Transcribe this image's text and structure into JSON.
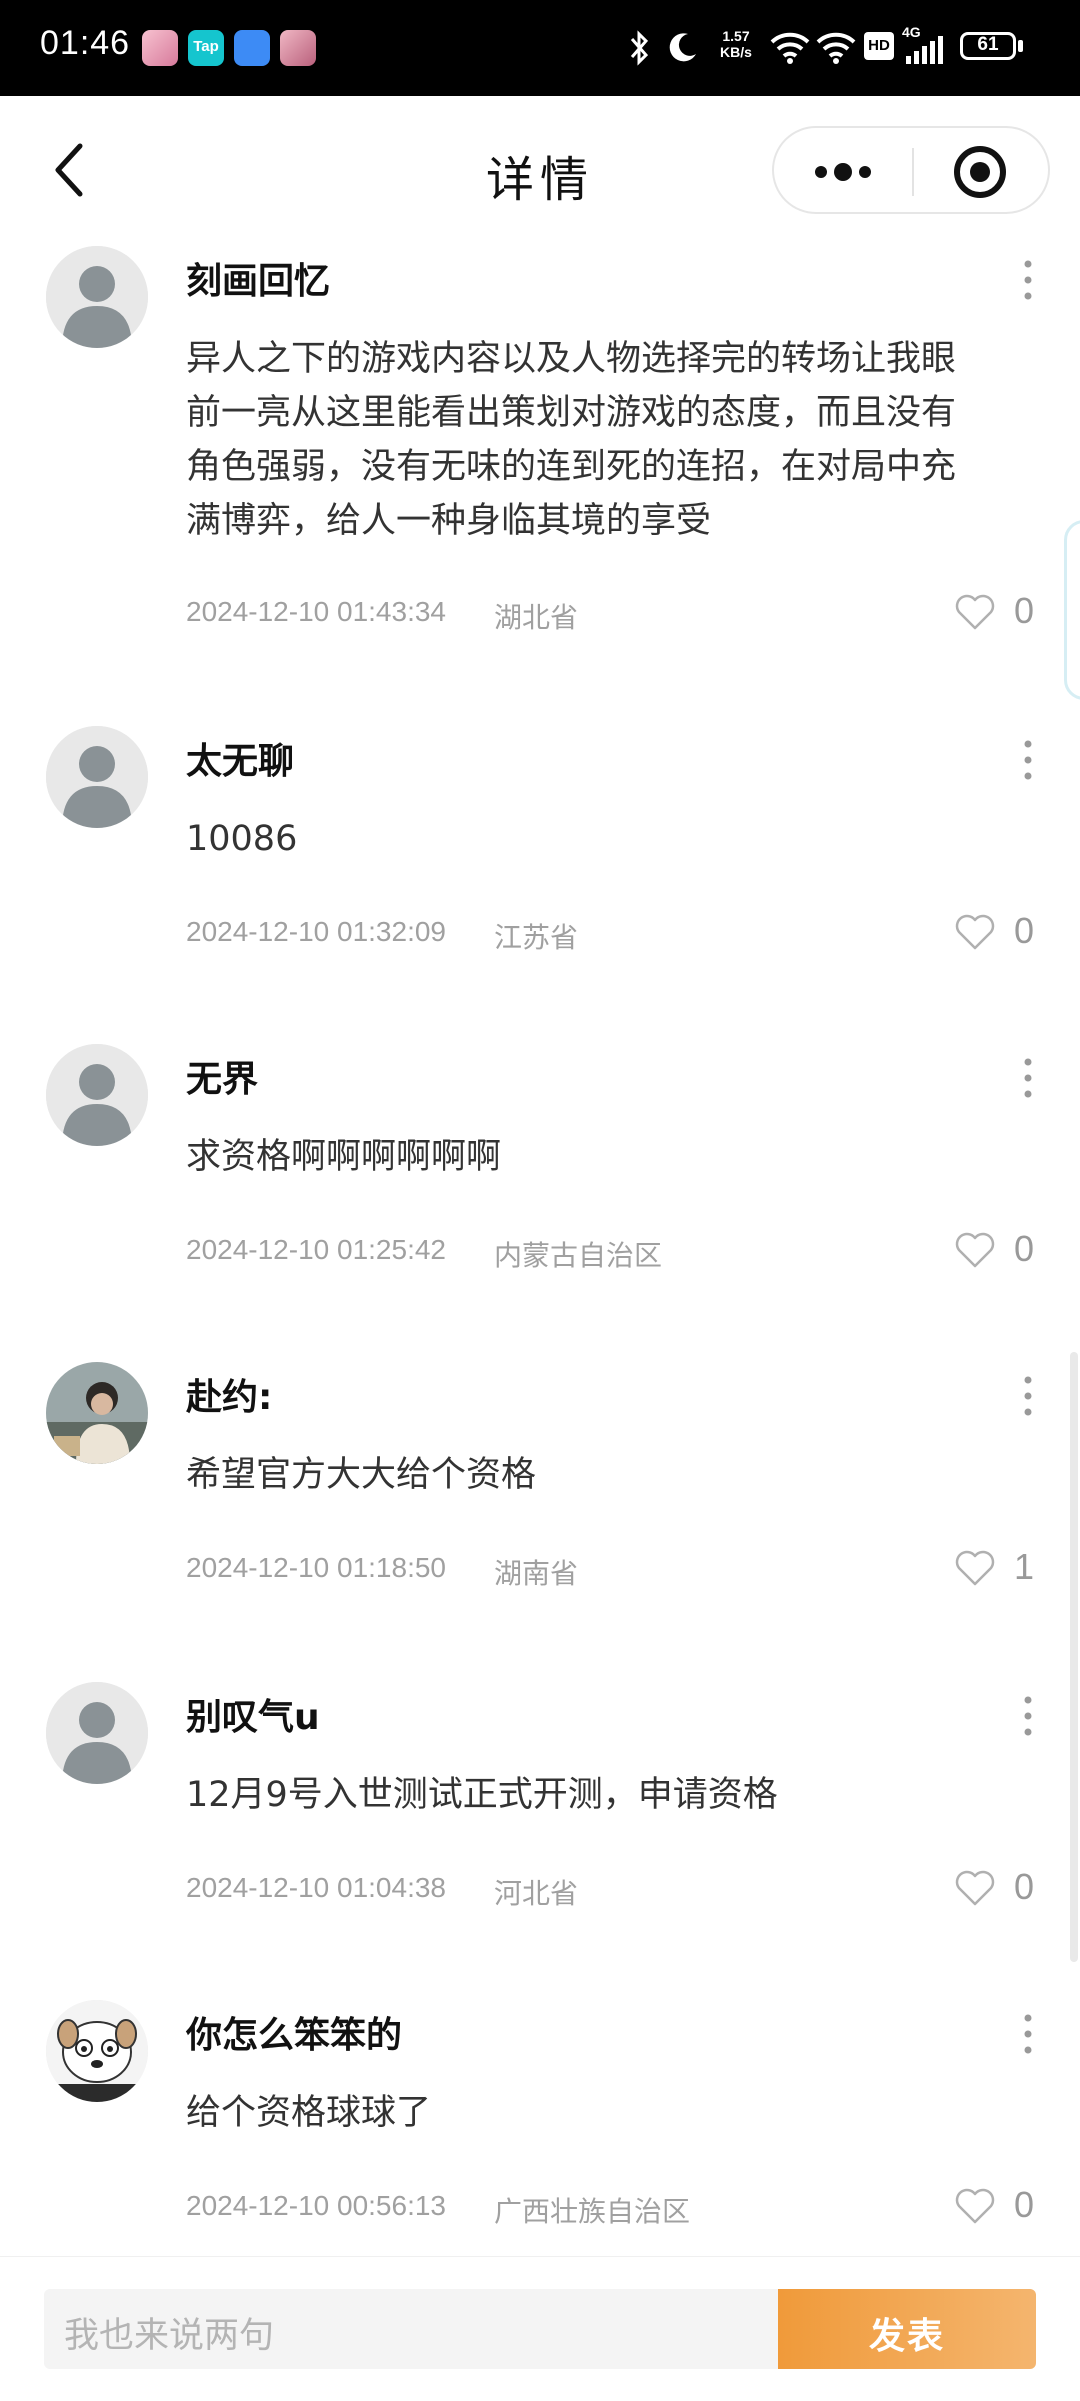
{
  "status_bar": {
    "time": "01:46",
    "net_speed_value": "1.57",
    "net_speed_unit": "KB/s",
    "hd_label": "HD",
    "network_type": "4G",
    "battery": "61",
    "app_icons": [
      "game-app-icon",
      "taptap-app-icon",
      "store-app-icon",
      "game-app-icon-2"
    ],
    "taptap_label": "Tap"
  },
  "header": {
    "title": "详情",
    "back_icon": "chevron-left-icon",
    "more_icon": "more-dots-icon",
    "close_icon": "target-icon"
  },
  "comments": [
    {
      "username": "刻画回忆",
      "lines": [
        "异人之下的游戏内容以及人物选择完的转场让我眼",
        "前一亮从这里能看出策划对游戏的态度，而且没有",
        "角色强弱，没有无味的连到死的连招，在对局中充",
        "满博弈，给人一种身临其境的享受"
      ],
      "time": "2024-12-10 01:43:34",
      "region": "湖北省",
      "likes": "0",
      "avatar": "default"
    },
    {
      "username": "太无聊",
      "lines": [
        "10086"
      ],
      "time": "2024-12-10 01:32:09",
      "region": "江苏省",
      "likes": "0",
      "avatar": "default"
    },
    {
      "username": "无界",
      "lines": [
        "求资格啊啊啊啊啊啊"
      ],
      "time": "2024-12-10 01:25:42",
      "region": "内蒙古自治区",
      "likes": "0",
      "avatar": "default"
    },
    {
      "username": "赴约:",
      "lines": [
        "希望官方大大给个资格"
      ],
      "time": "2024-12-10 01:18:50",
      "region": "湖南省",
      "likes": "1",
      "avatar": "photo"
    },
    {
      "username": "别叹气u",
      "lines": [
        "12月9号入世测试正式开测，申请资格"
      ],
      "time": "2024-12-10 01:04:38",
      "region": "河北省",
      "likes": "0",
      "avatar": "default"
    },
    {
      "username": "你怎么笨笨的",
      "lines": [
        "给个资格球球了"
      ],
      "time": "2024-12-10 00:56:13",
      "region": "广西壮族自治区",
      "likes": "0",
      "avatar": "cartoon"
    }
  ],
  "comment_input": {
    "placeholder": "我也来说两句",
    "send_label": "发表"
  },
  "colors": {
    "accent": "#f0a04b",
    "meta_text": "#a0a0a0",
    "avatar_default": "#8a9296"
  }
}
